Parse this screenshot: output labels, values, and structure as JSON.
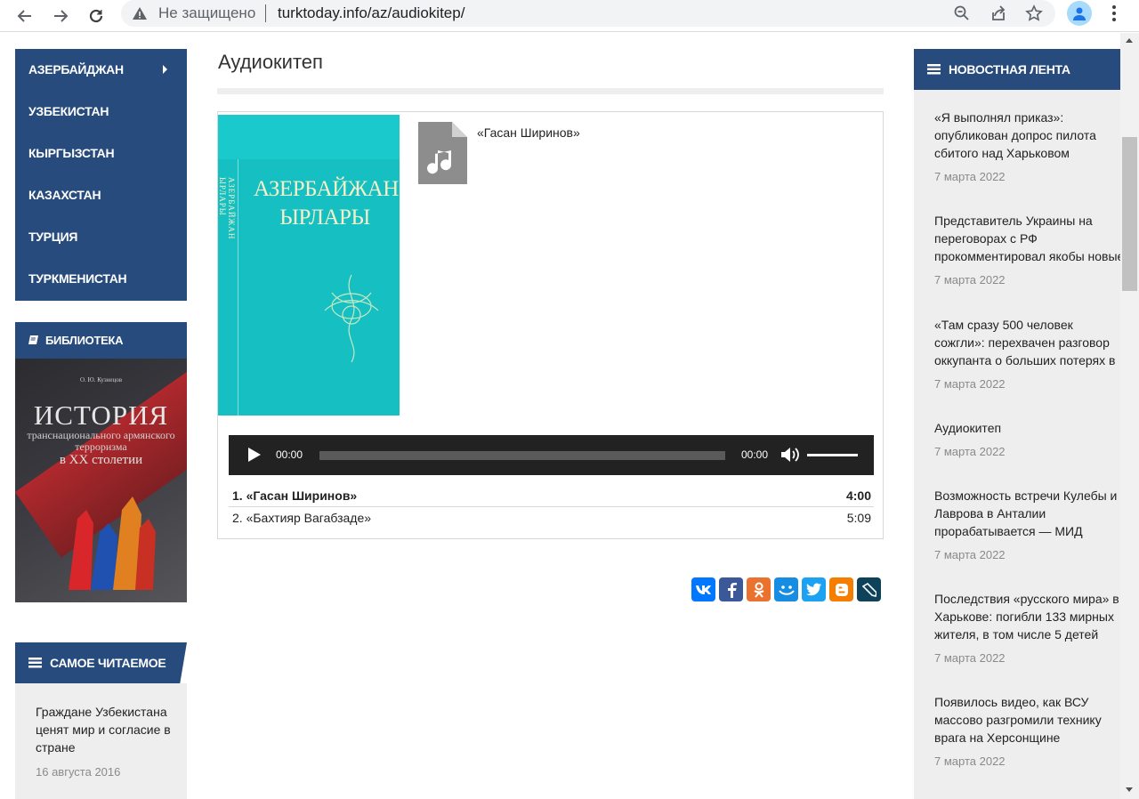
{
  "browser": {
    "security_status": "Не защищено",
    "url": "turktoday.info/az/audiokitep/"
  },
  "left_nav": {
    "items": [
      {
        "label": "АЗЕРБАЙДЖАН"
      },
      {
        "label": "УЗБЕКИСТАН"
      },
      {
        "label": "КЫРГЫЗСТАН"
      },
      {
        "label": "КАЗАХСТАН"
      },
      {
        "label": "ТУРЦИЯ"
      },
      {
        "label": "ТУРКМЕНИСТАН"
      }
    ]
  },
  "library": {
    "heading": "БИБЛИОТЕКА",
    "book": {
      "author": "О. Ю. Кузнецов",
      "title": "ИСТОРИЯ",
      "subtitle": "транснационального армянского терроризма",
      "subtitle2": "в XX столетии"
    }
  },
  "most_read": {
    "heading": "САМОЕ ЧИТАЕМОЕ",
    "item": {
      "title": "Граждане Узбекистана ценят мир и согласие в стране",
      "date": "16 августа 2016"
    }
  },
  "main": {
    "page_title": "Аудиокитеп",
    "album": {
      "cover_title": "АЗЕРБАЙЖАН ЫРЛАРЫ",
      "cover_vertical": "АЗЕРБАЙЖАН ЫРЛАРЫ",
      "current_track": "«Гасан Ширинов»"
    },
    "player": {
      "current_time": "00:00",
      "duration": "00:00",
      "volume": 1.0
    },
    "playlist": [
      {
        "label": "1. «Гасан Ширинов»",
        "duration": "4:00",
        "active": true
      },
      {
        "label": "2. «Бахтияр Вагабзаде»",
        "duration": "5:09",
        "active": false
      }
    ],
    "share": [
      {
        "name": "vk",
        "glyph": "vk",
        "color": "#0077ff"
      },
      {
        "name": "facebook",
        "glyph": "f",
        "color": "#3b5998"
      },
      {
        "name": "odnoklassniki",
        "glyph": "ok",
        "color": "#eb722e"
      },
      {
        "name": "moimir",
        "glyph": "mm",
        "color": "#168de2"
      },
      {
        "name": "twitter",
        "glyph": "tw",
        "color": "#1da1f2"
      },
      {
        "name": "blogger",
        "glyph": "B",
        "color": "#f57d00"
      },
      {
        "name": "livejournal",
        "glyph": "lj",
        "color": "#0d425a"
      }
    ]
  },
  "news_feed": {
    "heading": "НОВОСТНАЯ ЛЕНТА",
    "items": [
      {
        "lines": [
          "«Я выполнял приказ»:",
          "опубликован допрос пилота",
          "сбитого над Харьковом"
        ],
        "date": "7 марта 2022"
      },
      {
        "lines": [
          "Представитель Украины на",
          "переговорах с РФ",
          "прокомментировал якобы новые"
        ],
        "date": "7 марта 2022"
      },
      {
        "lines": [
          "«Там сразу 500 человек",
          "сожгли»: перехвачен разговор",
          "оккупанта о больших потерях в"
        ],
        "date": "7 марта 2022"
      },
      {
        "lines": [
          "Аудиокитеп"
        ],
        "date": "7 марта 2022"
      },
      {
        "lines": [
          "Возможность встречи Кулебы и",
          "Лаврова в Анталии",
          "прорабатывается — МИД"
        ],
        "date": "7 марта 2022"
      },
      {
        "lines": [
          "Последствия «русского мира» в",
          "Харькове: погибли 133 мирных",
          "жителя, в том числе 5 детей"
        ],
        "date": "7 марта 2022"
      },
      {
        "lines": [
          "Появилось видео, как ВСУ",
          "массово разгромили технику",
          "врага на Херсонщине"
        ],
        "date": "7 марта 2022"
      }
    ]
  }
}
